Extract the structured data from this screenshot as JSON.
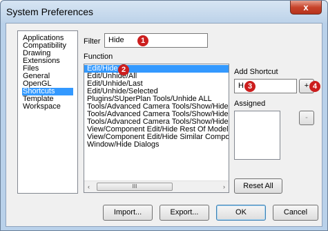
{
  "window": {
    "title": "System Preferences",
    "close_glyph": "x"
  },
  "categories": {
    "items": [
      "Applications",
      "Compatibility",
      "Drawing",
      "Extensions",
      "Files",
      "General",
      "OpenGL",
      "Shortcuts",
      "Template",
      "Workspace"
    ],
    "selected": "Shortcuts"
  },
  "filter": {
    "label": "Filter",
    "value": "Hide"
  },
  "function": {
    "label": "Function",
    "items": [
      "Edit/Hide",
      "Edit/Unhide/All",
      "Edit/Unhide/Last",
      "Edit/Unhide/Selected",
      "Plugins/SUperPlan Tools/Unhide ALL",
      "Tools/Advanced Camera Tools/Show/Hide",
      "Tools/Advanced Camera Tools/Show/Hide",
      "Tools/Advanced Camera Tools/Show/Hide",
      "View/Component Edit/Hide Rest Of Model",
      "View/Component Edit/Hide Similar Compon",
      "Window/Hide Dialogs"
    ],
    "selected": "Edit/Hide",
    "scroll_left": "‹",
    "scroll_thumb": "III",
    "scroll_right": "›"
  },
  "add_shortcut": {
    "label": "Add Shortcut",
    "value": "H",
    "add_button": "+"
  },
  "assigned": {
    "label": "Assigned",
    "remove_button": "-"
  },
  "buttons": {
    "reset_all": "Reset All",
    "import": "Import...",
    "export": "Export...",
    "ok": "OK",
    "cancel": "Cancel"
  },
  "badges": {
    "one": "1",
    "two": "2",
    "three": "3",
    "four": "4"
  },
  "colors": {
    "badge": "#cc1e1e",
    "selection": "#3399ff"
  }
}
